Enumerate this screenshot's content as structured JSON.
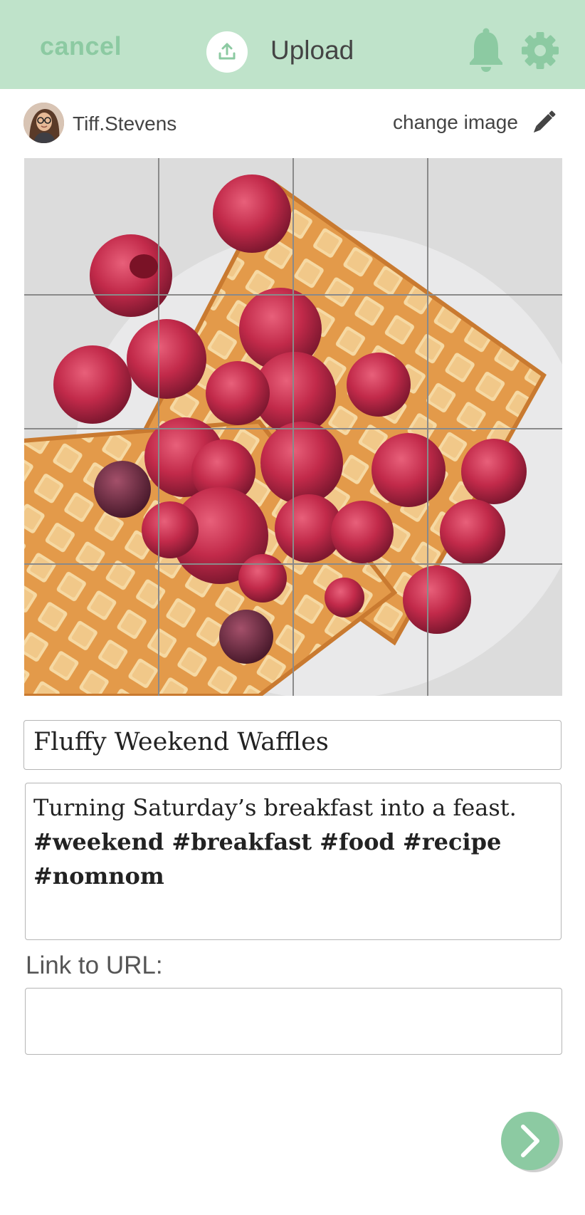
{
  "header": {
    "cancel_label": "cancel",
    "title": "Upload",
    "icons": [
      "upload-icon",
      "bell-icon",
      "gear-icon"
    ],
    "colors": {
      "bar": "#bfe3ca",
      "accent": "#8ccaa2"
    }
  },
  "user": {
    "name": "Tiff.Stevens",
    "change_image_label": "change image"
  },
  "photo": {
    "subject": "waffles with raspberries",
    "grid": "4x4 crop guide"
  },
  "form": {
    "title_value": "Fluffy Weekend Waffles",
    "caption_text": "Turning Saturday’s breakfast into a feast.",
    "caption_tags": "#weekend #breakfast #food #recipe #nomnom",
    "link_label": "Link to URL:",
    "url_value": ""
  },
  "next_icon": "chevron-right-icon"
}
